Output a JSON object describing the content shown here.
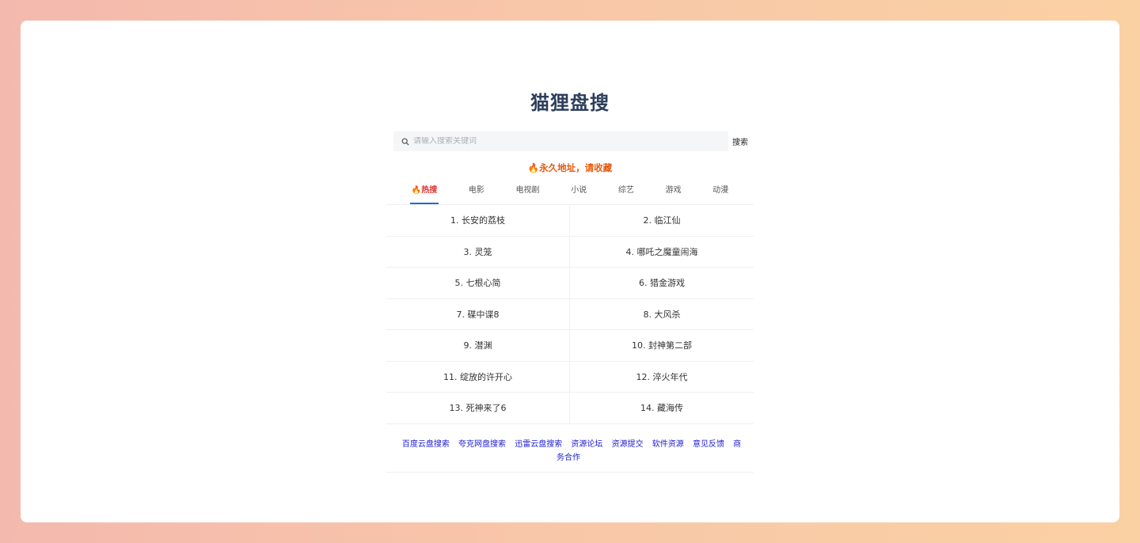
{
  "site": {
    "title": "猫狸盘搜"
  },
  "search": {
    "placeholder": "请输入搜索关键词",
    "value": "",
    "button_label": "搜索"
  },
  "notice": "🔥永久地址，请收藏",
  "tabs": [
    {
      "label": "🔥热搜",
      "active": true
    },
    {
      "label": "电影",
      "active": false
    },
    {
      "label": "电视剧",
      "active": false
    },
    {
      "label": "小说",
      "active": false
    },
    {
      "label": "综艺",
      "active": false
    },
    {
      "label": "游戏",
      "active": false
    },
    {
      "label": "动漫",
      "active": false
    }
  ],
  "hot_list": [
    "1. 长安的荔枝",
    "2. 临江仙",
    "3. 灵笼",
    "4. 哪吒之魔童闹海",
    "5. 七根心简",
    "6. 猎金游戏",
    "7. 碟中谍8",
    "8. 大风杀",
    "9. 潜渊",
    "10. 封神第二部",
    "11. 绽放的许开心",
    "12. 淬火年代",
    "13. 死神来了6",
    "14. 藏海传"
  ],
  "footer_links": [
    "百度云盘搜索",
    "夸克网盘搜索",
    "迅雷云盘搜索",
    "资源论坛",
    "资源提交",
    "软件资源",
    "意见反馈",
    "商务合作"
  ],
  "colors": {
    "accent": "#1c6fd1",
    "notice": "#e8590c",
    "link": "#1c1ccf",
    "title": "#2c3e5c"
  }
}
